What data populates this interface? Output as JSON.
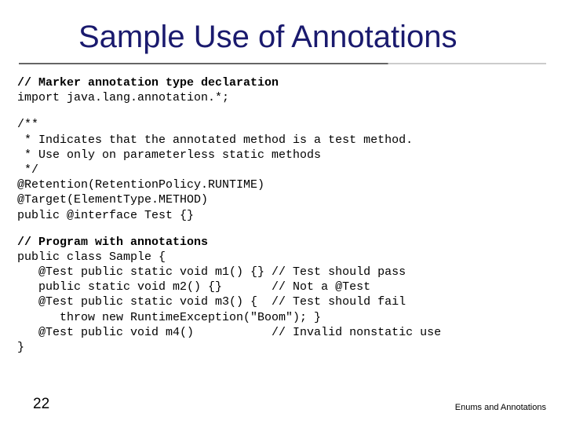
{
  "title": "Sample Use of Annotations",
  "code": {
    "declComment": "// Marker annotation type declaration",
    "importLine": "import java.lang.annotation.*;",
    "javadoc1": "/**",
    "javadoc2": " * Indicates that the annotated method is a test method.",
    "javadoc3": " * Use only on parameterless static methods",
    "javadoc4": " */",
    "retention": "@Retention(RetentionPolicy.RUNTIME)",
    "target": "@Target(ElementType.METHOD)",
    "iface": "public @interface Test {}",
    "programComment": "// Program with annotations",
    "classOpen": "public class Sample {",
    "m1": "   @Test public static void m1() {} // Test should pass",
    "m2": "   public static void m2() {}       // Not a @Test",
    "m3": "   @Test public static void m3() {  // Test should fail",
    "m3throw": "      throw new RuntimeException(\"Boom\"); }",
    "m4": "   @Test public void m4()           // Invalid nonstatic use",
    "classClose": "}"
  },
  "pageNumber": "22",
  "footerRight": "Enums and Annotations"
}
